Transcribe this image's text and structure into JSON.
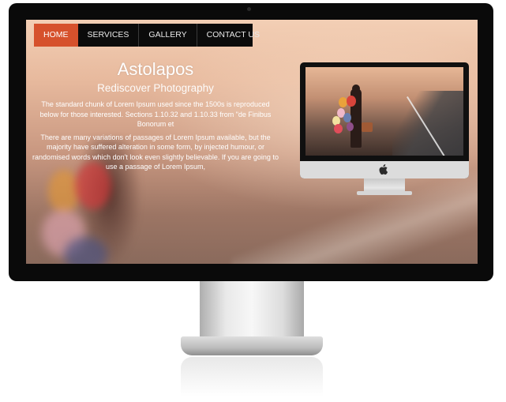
{
  "nav": {
    "items": [
      {
        "label": "HOME",
        "active": true
      },
      {
        "label": "SERVICES",
        "active": false
      },
      {
        "label": "GALLERY",
        "active": false
      },
      {
        "label": "CONTACT US",
        "active": false
      }
    ]
  },
  "hero": {
    "title": "Astolapos",
    "subtitle": "Rediscover Photography",
    "paragraph_1": "The standard chunk of Lorem Ipsum used since the 1500s is reproduced below for those interested. Sections 1.10.32 and 1.10.33 from \"de Finibus Bonorum et",
    "paragraph_2": "There are many variations of passages of Lorem Ipsum available, but the majority have suffered alteration in some form, by injected humour, or randomised words which don't look even slightly believable. If you are going to use a passage of Lorem Ipsum,"
  },
  "colors": {
    "accent": "#d6512c",
    "nav_background": "#0b0b0b",
    "bezel": "#0a0a0a"
  },
  "icons": {
    "logo": "apple-icon"
  }
}
